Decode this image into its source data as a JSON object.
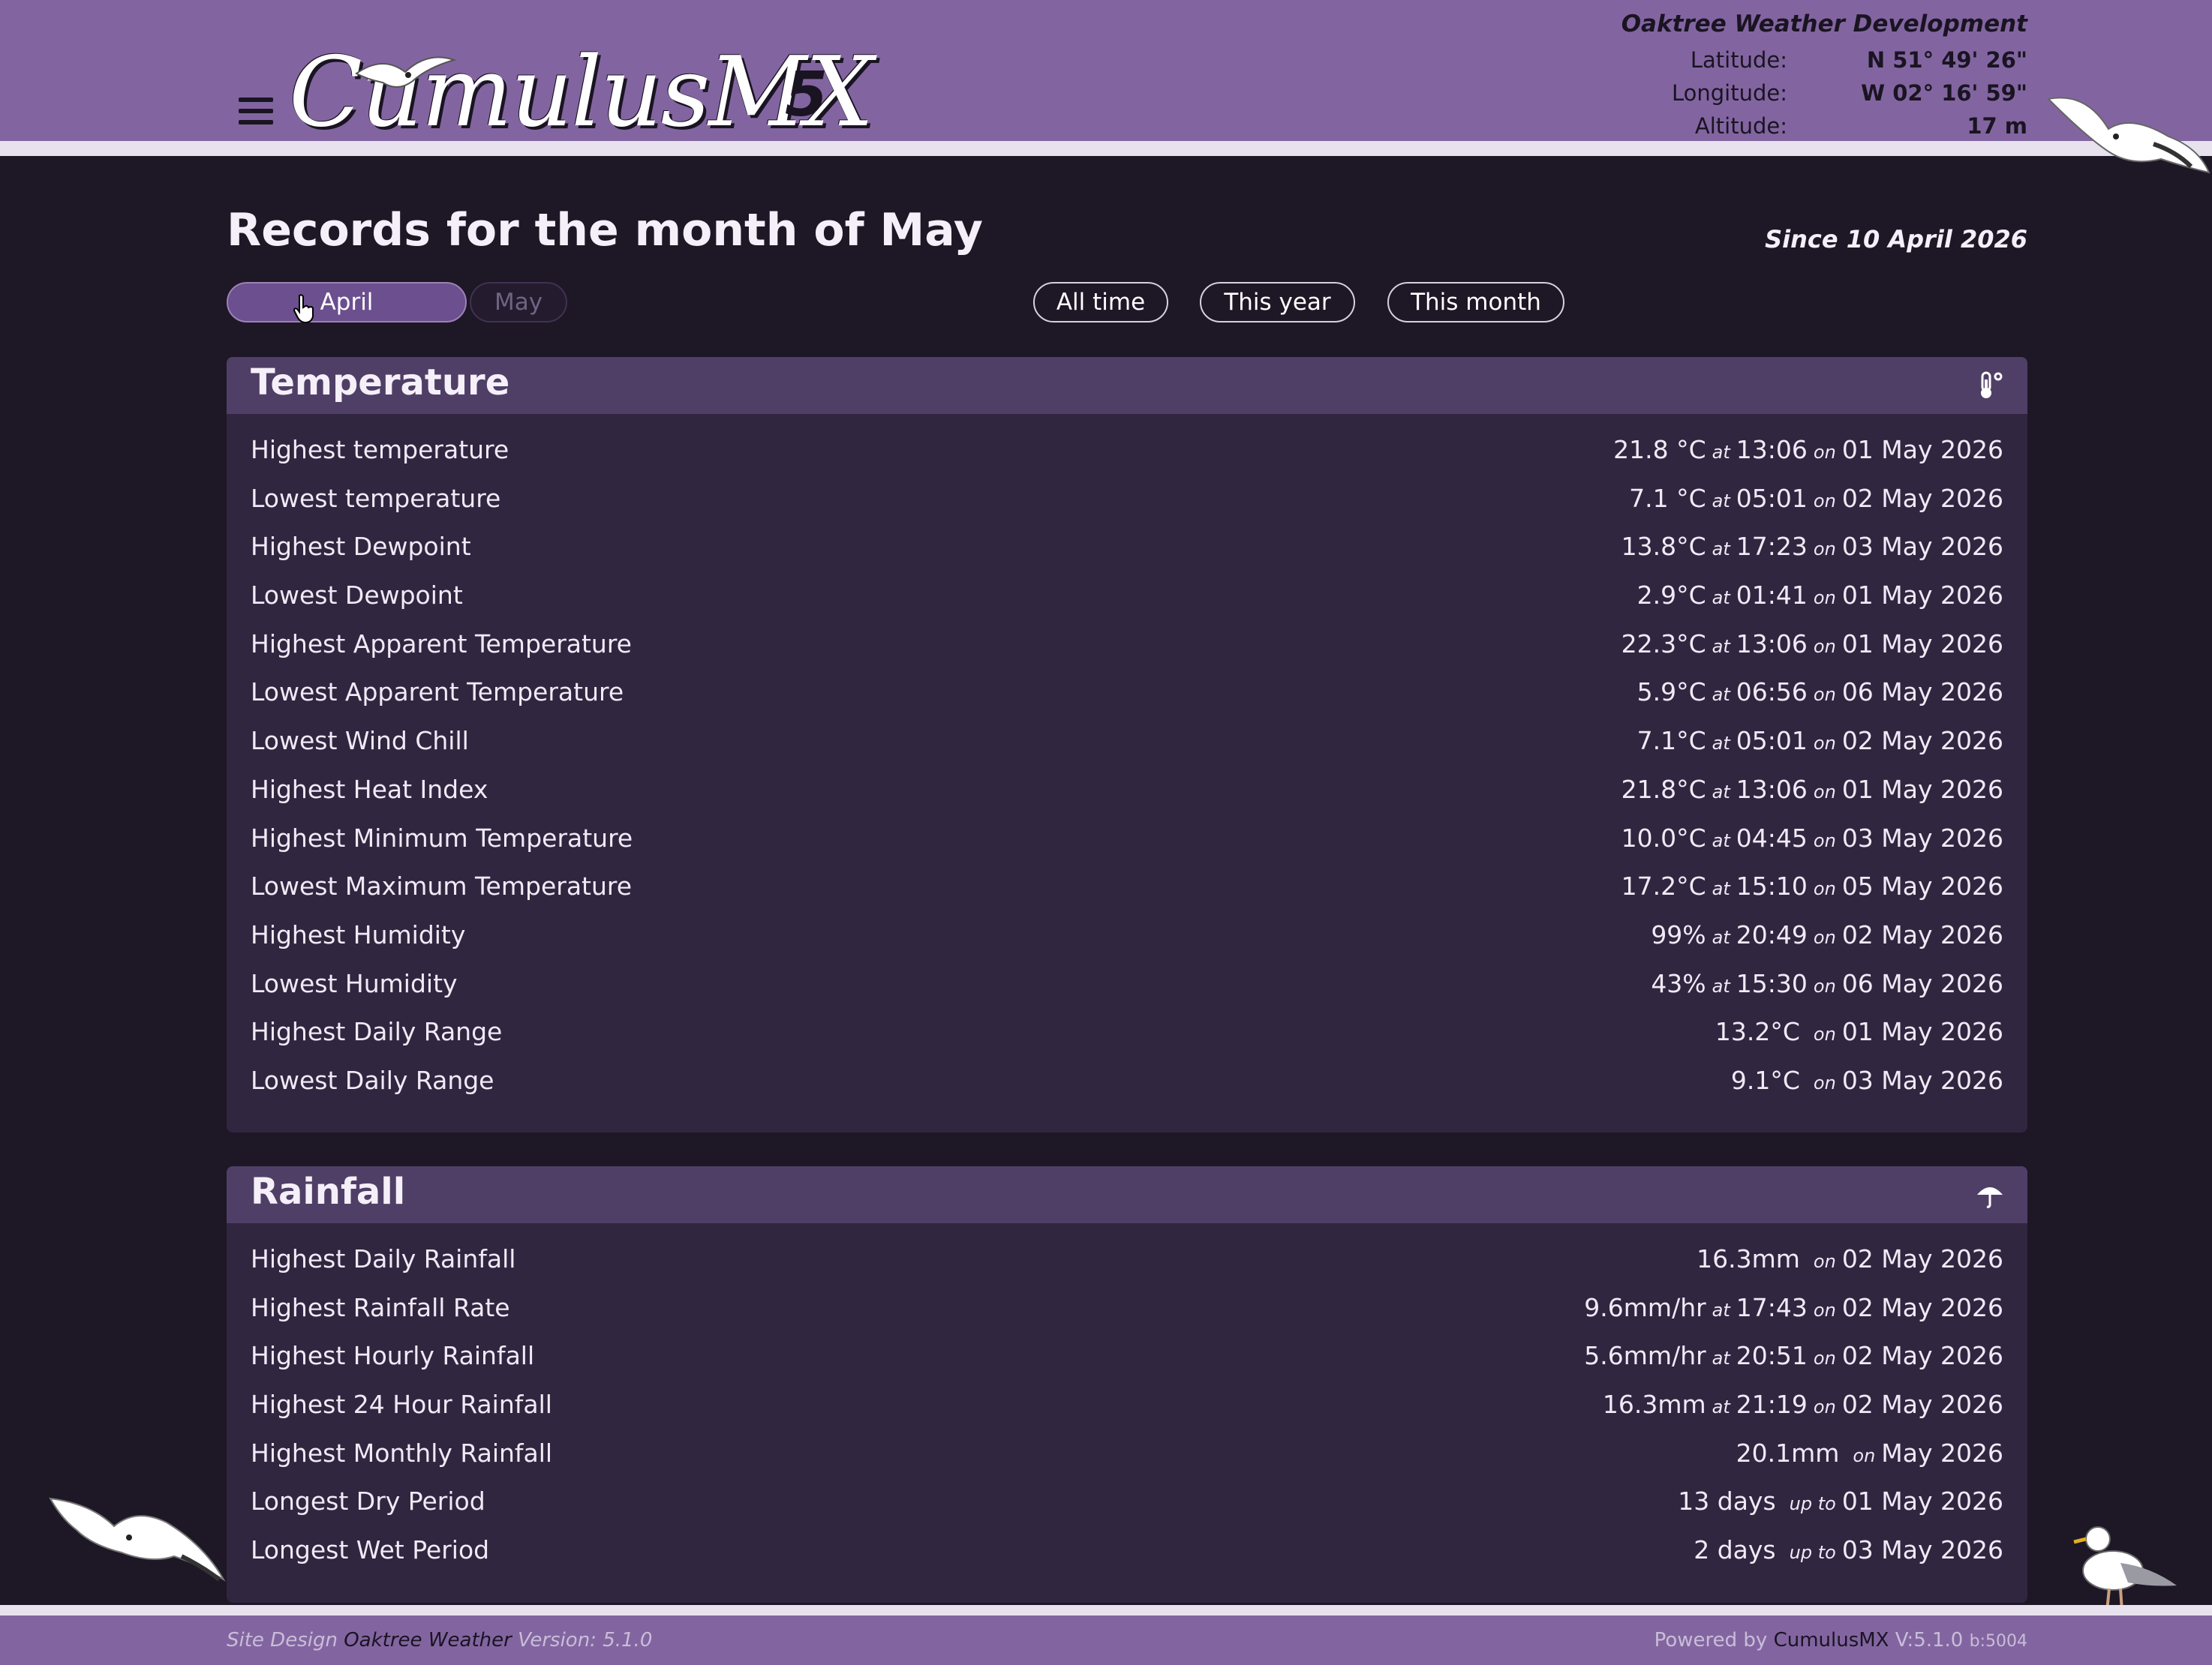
{
  "header": {
    "logo_text": "CumulusMX",
    "logo_version": "5",
    "station_name": "Oaktree Weather Development",
    "latitude_label": "Latitude:",
    "latitude_value": "N 51° 49' 26\"",
    "longitude_label": "Longitude:",
    "longitude_value": "W 02° 16' 59\"",
    "altitude_label": "Altitude:",
    "altitude_value": "17 m"
  },
  "page": {
    "title": "Records for the month of May",
    "since": "Since 10 April 2026"
  },
  "month_buttons": {
    "april": "April",
    "may": "May"
  },
  "period_buttons": {
    "all_time": "All time",
    "this_year": "This year",
    "this_month": "This month"
  },
  "temperature": {
    "title": "Temperature",
    "icon": "thermometer-icon",
    "rows": [
      {
        "label": "Highest temperature",
        "value": "21.8 °C",
        "time": "13:06",
        "date": "01 May 2026"
      },
      {
        "label": "Lowest temperature",
        "value": "7.1 °C",
        "time": "05:01",
        "date": "02 May 2026"
      },
      {
        "label": "Highest Dewpoint",
        "value": "13.8°C",
        "time": "17:23",
        "date": "03 May 2026"
      },
      {
        "label": "Lowest Dewpoint",
        "value": "2.9°C",
        "time": "01:41",
        "date": "01 May 2026"
      },
      {
        "label": "Highest Apparent Temperature",
        "value": "22.3°C",
        "time": "13:06",
        "date": "01 May 2026"
      },
      {
        "label": "Lowest Apparent Temperature",
        "value": "5.9°C",
        "time": "06:56",
        "date": "06 May 2026"
      },
      {
        "label": "Lowest Wind Chill",
        "value": "7.1°C",
        "time": "05:01",
        "date": "02 May 2026"
      },
      {
        "label": "Highest Heat Index",
        "value": "21.8°C",
        "time": "13:06",
        "date": "01 May 2026"
      },
      {
        "label": "Highest Minimum Temperature",
        "value": "10.0°C",
        "time": "04:45",
        "date": "03 May 2026"
      },
      {
        "label": "Lowest Maximum Temperature",
        "value": "17.2°C",
        "time": "15:10",
        "date": "05 May 2026"
      },
      {
        "label": "Highest Humidity",
        "value": "99%",
        "time": "20:49",
        "date": "02 May 2026"
      },
      {
        "label": "Lowest Humidity",
        "value": "43%",
        "time": "15:30",
        "date": "06 May 2026"
      },
      {
        "label": "Highest Daily Range",
        "value": "13.2°C",
        "time": "",
        "date": "01 May 2026"
      },
      {
        "label": "Lowest Daily Range",
        "value": "9.1°C",
        "time": "",
        "date": "03 May 2026"
      }
    ]
  },
  "rainfall": {
    "title": "Rainfall",
    "icon": "umbrella-icon",
    "rows": [
      {
        "label": "Highest Daily Rainfall",
        "value": "16.3mm",
        "time": "",
        "prefix": "on",
        "date": "02 May 2026"
      },
      {
        "label": "Highest Rainfall Rate",
        "value": "9.6mm/hr",
        "time": "17:43",
        "prefix": "on",
        "date": "02 May 2026"
      },
      {
        "label": "Highest Hourly Rainfall",
        "value": "5.6mm/hr",
        "time": "20:51",
        "prefix": "on",
        "date": "02 May 2026"
      },
      {
        "label": "Highest 24 Hour Rainfall",
        "value": "16.3mm",
        "time": "21:19",
        "prefix": "on",
        "date": "02 May 2026"
      },
      {
        "label": "Highest Monthly Rainfall",
        "value": "20.1mm",
        "time": "",
        "prefix": "on",
        "date": "May 2026"
      },
      {
        "label": "Longest Dry Period",
        "value": "13 days",
        "time": "",
        "prefix": "up to",
        "date": "01 May 2026"
      },
      {
        "label": "Longest Wet Period",
        "value": "2 days",
        "time": "",
        "prefix": "up to",
        "date": "03 May 2026"
      }
    ]
  },
  "words": {
    "at": "at",
    "on": "on"
  },
  "footer": {
    "design_prefix": "Site Design",
    "design_name": "Oaktree Weather",
    "design_version": "Version: 5.1.0",
    "powered_prefix": "Powered by",
    "powered_name": "CumulusMX",
    "powered_version": "V:5.1.0",
    "powered_build": "b:5004"
  },
  "colors": {
    "header_bg": "#8265a0",
    "page_bg": "#1e1726",
    "panel_bg": "#30263f",
    "panel_head_bg": "#4f3f66"
  }
}
